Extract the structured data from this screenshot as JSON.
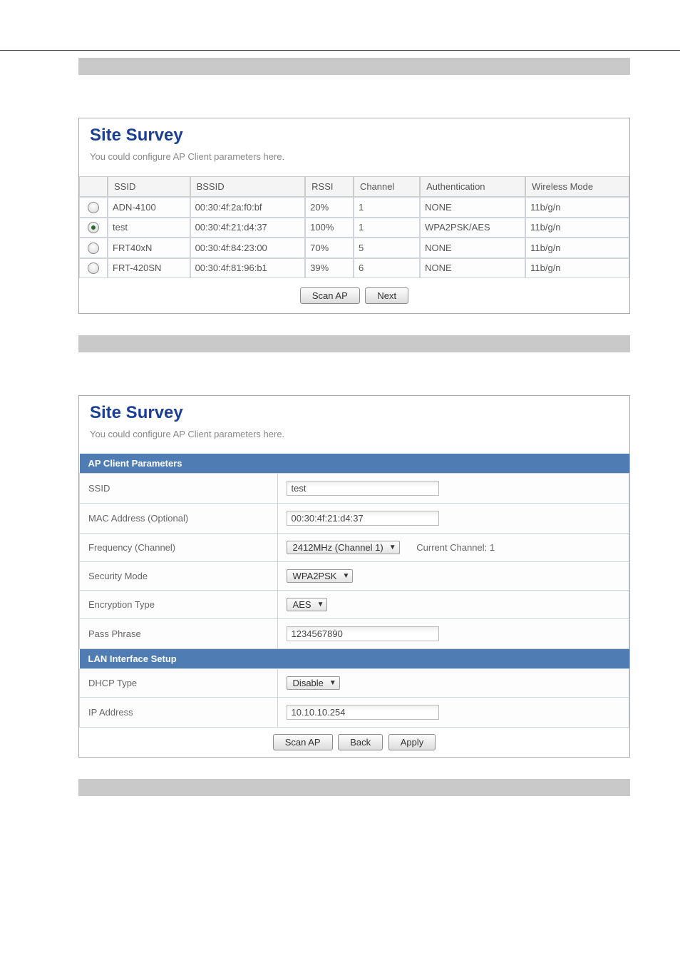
{
  "survey1": {
    "title": "Site Survey",
    "subtitle": "You could configure AP Client parameters here.",
    "headers": {
      "ssid": "SSID",
      "bssid": "BSSID",
      "rssi": "RSSI",
      "channel": "Channel",
      "auth": "Authentication",
      "mode": "Wireless Mode"
    },
    "rows": [
      {
        "ssid": "ADN-4100",
        "bssid": "00:30:4f:2a:f0:bf",
        "rssi": "20%",
        "channel": "1",
        "auth": "NONE",
        "mode": "11b/g/n",
        "selected": false
      },
      {
        "ssid": "test",
        "bssid": "00:30:4f:21:d4:37",
        "rssi": "100%",
        "channel": "1",
        "auth": "WPA2PSK/AES",
        "mode": "11b/g/n",
        "selected": true
      },
      {
        "ssid": "FRT40xN",
        "bssid": "00:30:4f:84:23:00",
        "rssi": "70%",
        "channel": "5",
        "auth": "NONE",
        "mode": "11b/g/n",
        "selected": false
      },
      {
        "ssid": "FRT-420SN",
        "bssid": "00:30:4f:81:96:b1",
        "rssi": "39%",
        "channel": "6",
        "auth": "NONE",
        "mode": "11b/g/n",
        "selected": false
      }
    ],
    "buttons": {
      "scan": "Scan AP",
      "next": "Next"
    }
  },
  "survey2": {
    "title": "Site Survey",
    "subtitle": "You could configure AP Client parameters here.",
    "section1": "AP Client Parameters",
    "ssid_label": "SSID",
    "ssid_value": "test",
    "mac_label": "MAC Address (Optional)",
    "mac_value": "00:30:4f:21:d4:37",
    "freq_label": "Frequency (Channel)",
    "freq_value": "2412MHz (Channel 1)",
    "freq_note": "Current Channel: 1",
    "sec_label": "Security Mode",
    "sec_value": "WPA2PSK",
    "enc_label": "Encryption Type",
    "enc_value": "AES",
    "pass_label": "Pass Phrase",
    "pass_value": "1234567890",
    "section2": "LAN Interface Setup",
    "dhcp_label": "DHCP Type",
    "dhcp_value": "Disable",
    "ip_label": "IP Address",
    "ip_value": "10.10.10.254",
    "buttons": {
      "scan": "Scan AP",
      "back": "Back",
      "apply": "Apply"
    }
  }
}
